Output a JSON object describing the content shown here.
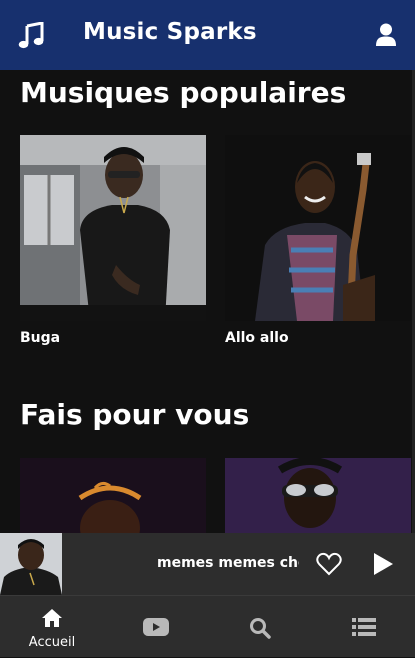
{
  "app": {
    "title": "Music Sparks"
  },
  "sections": [
    {
      "title": "Musiques populaires",
      "items": [
        {
          "title": "Buga"
        },
        {
          "title": "Allo allo"
        }
      ]
    },
    {
      "title": "Fais pour vous"
    }
  ],
  "player": {
    "track_title": "memes memes choses"
  },
  "nav": [
    {
      "label": "Accueil",
      "icon": "home-icon"
    },
    {
      "label": "",
      "icon": "video-icon"
    },
    {
      "label": "",
      "icon": "search-icon"
    },
    {
      "label": "",
      "icon": "list-icon"
    }
  ],
  "colors": {
    "appbar": "#17306e",
    "background": "#111111",
    "bars": "#2d2d2d"
  }
}
